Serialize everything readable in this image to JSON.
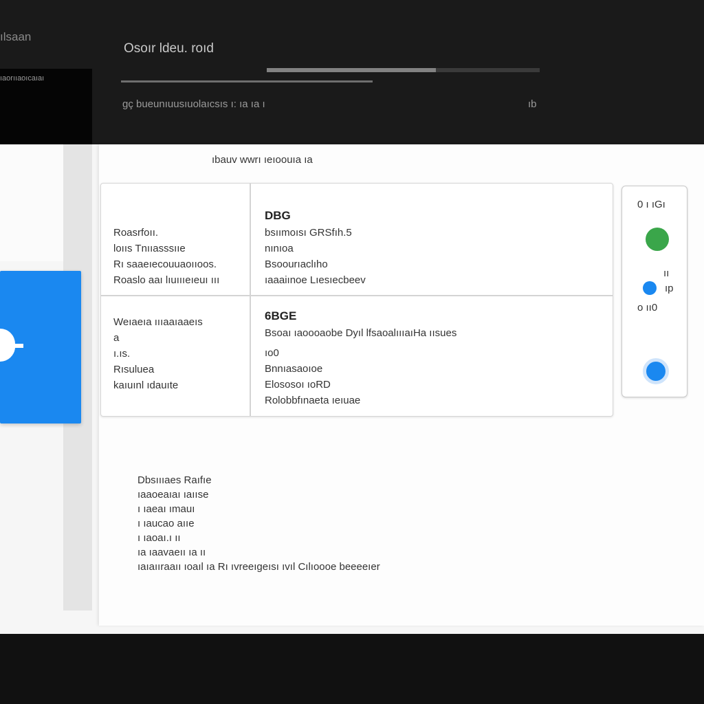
{
  "app": {
    "brand": "ılsaan",
    "left_label": "ıaorııaoıcaıaı"
  },
  "header": {
    "title": "Osoır ldeu. roıd",
    "progress_fraction": 0.62,
    "path": "gç bueunıuusıuolaıcsıs ı:  ıa ıa ı",
    "path_end": "ıb"
  },
  "content": {
    "heading": "ıbauv wwrı ıeıoouıa ıa",
    "rows": [
      {
        "left": [
          "Roasrfoıı.",
          "loııs Tnııasssııe",
          "Rı saaeıecouuaoııoos.",
          "Roaslo aaı lıuıııeıeuı ııı"
        ],
        "right_head": "DBG",
        "right": [
          "bsıımoısı GRSfıh.5",
          "nınıoa",
          "Bsoourıaclıho",
          "ıaaaiınoe Lıesıecbeev"
        ]
      },
      {
        "left": [
          "Weıaeıa ıııaaıaaeıs",
          "",
          "a",
          "ı.ıs.",
          "Rısuluea",
          "kaıuınl ıdauıte"
        ],
        "right_head": "6BGE",
        "right_sub": "Bsoaı ıaoooaobe  Dyıl lfsaoalıııaıHa ıısues",
        "right": [
          "ıo0",
          "Bnnıasaoıoe",
          "Elososoı ıoRD",
          "Rolobbfınaeta ıeıuae"
        ]
      }
    ]
  },
  "side_panel": {
    "rows": [
      "0 ı ıGı",
      "ıı",
      "ıı",
      "ıp",
      "o ıı0"
    ]
  },
  "notes": [
    "Dbsıııaes Raıfıe",
    "ıaaoeaıaı ıaııse",
    "ı ıaeaı ımauı",
    "ı ıaucao aııe",
    "ı ıaoaı.ı ıı",
    "ıa ıaavaeıı ıa ıı",
    "ıaıaııraaıı ıoaıl  ıa Rı ıvreeıgeısı ıvıl Cılıoooe beeeeıer"
  ],
  "colors": {
    "accent_blue": "#1a88f0",
    "status_green": "#3aa64a",
    "dark_bg": "#1a1a1a"
  }
}
